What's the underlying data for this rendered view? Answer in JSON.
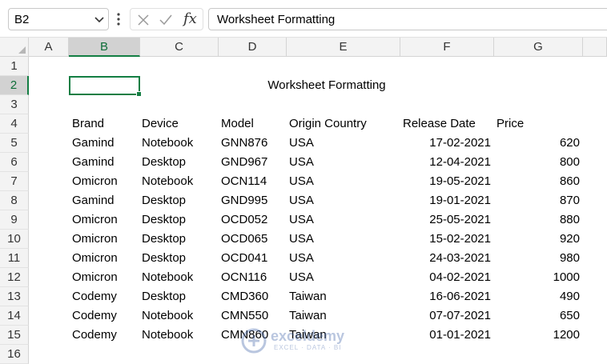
{
  "name_box": {
    "value": "B2"
  },
  "formula_bar": {
    "fx_label": "fx",
    "value": "Worksheet Formatting"
  },
  "columns": [
    "A",
    "B",
    "C",
    "D",
    "E",
    "F",
    "G"
  ],
  "rows": [
    "1",
    "2",
    "3",
    "4",
    "5",
    "6",
    "7",
    "8",
    "9",
    "10",
    "11",
    "12",
    "13",
    "14",
    "15",
    "16"
  ],
  "sheet": {
    "title": "Worksheet Formatting",
    "headers": [
      "Brand",
      "Device",
      "Model",
      "Origin Country",
      "Release Date",
      "Price"
    ],
    "data": [
      [
        "Gamind",
        "Notebook",
        "GNN876",
        "USA",
        "17-02-2021",
        "620"
      ],
      [
        "Gamind",
        "Desktop",
        "GND967",
        "USA",
        "12-04-2021",
        "800"
      ],
      [
        "Omicron",
        "Notebook",
        "OCN114",
        "USA",
        "19-05-2021",
        "860"
      ],
      [
        "Gamind",
        "Desktop",
        "GND995",
        "USA",
        "19-01-2021",
        "870"
      ],
      [
        "Omicron",
        "Desktop",
        "OCD052",
        "USA",
        "25-05-2021",
        "880"
      ],
      [
        "Omicron",
        "Desktop",
        "OCD065",
        "USA",
        "15-02-2021",
        "920"
      ],
      [
        "Omicron",
        "Desktop",
        "OCD041",
        "USA",
        "24-03-2021",
        "980"
      ],
      [
        "Omicron",
        "Notebook",
        "OCN116",
        "USA",
        "04-02-2021",
        "1000"
      ],
      [
        "Codemy",
        "Desktop",
        "CMD360",
        "Taiwan",
        "16-06-2021",
        "490"
      ],
      [
        "Codemy",
        "Notebook",
        "CMN550",
        "Taiwan",
        "07-07-2021",
        "650"
      ],
      [
        "Codemy",
        "Notebook",
        "CMN860",
        "Taiwan",
        "01-01-2021",
        "1200"
      ]
    ]
  },
  "watermark": {
    "name": "exceldemy",
    "tagline": "EXCEL · DATA · BI"
  },
  "colors": {
    "selection": "#137e43",
    "header_bg": "#f3f3f3",
    "header_selected_bg": "#d2d2d2"
  }
}
